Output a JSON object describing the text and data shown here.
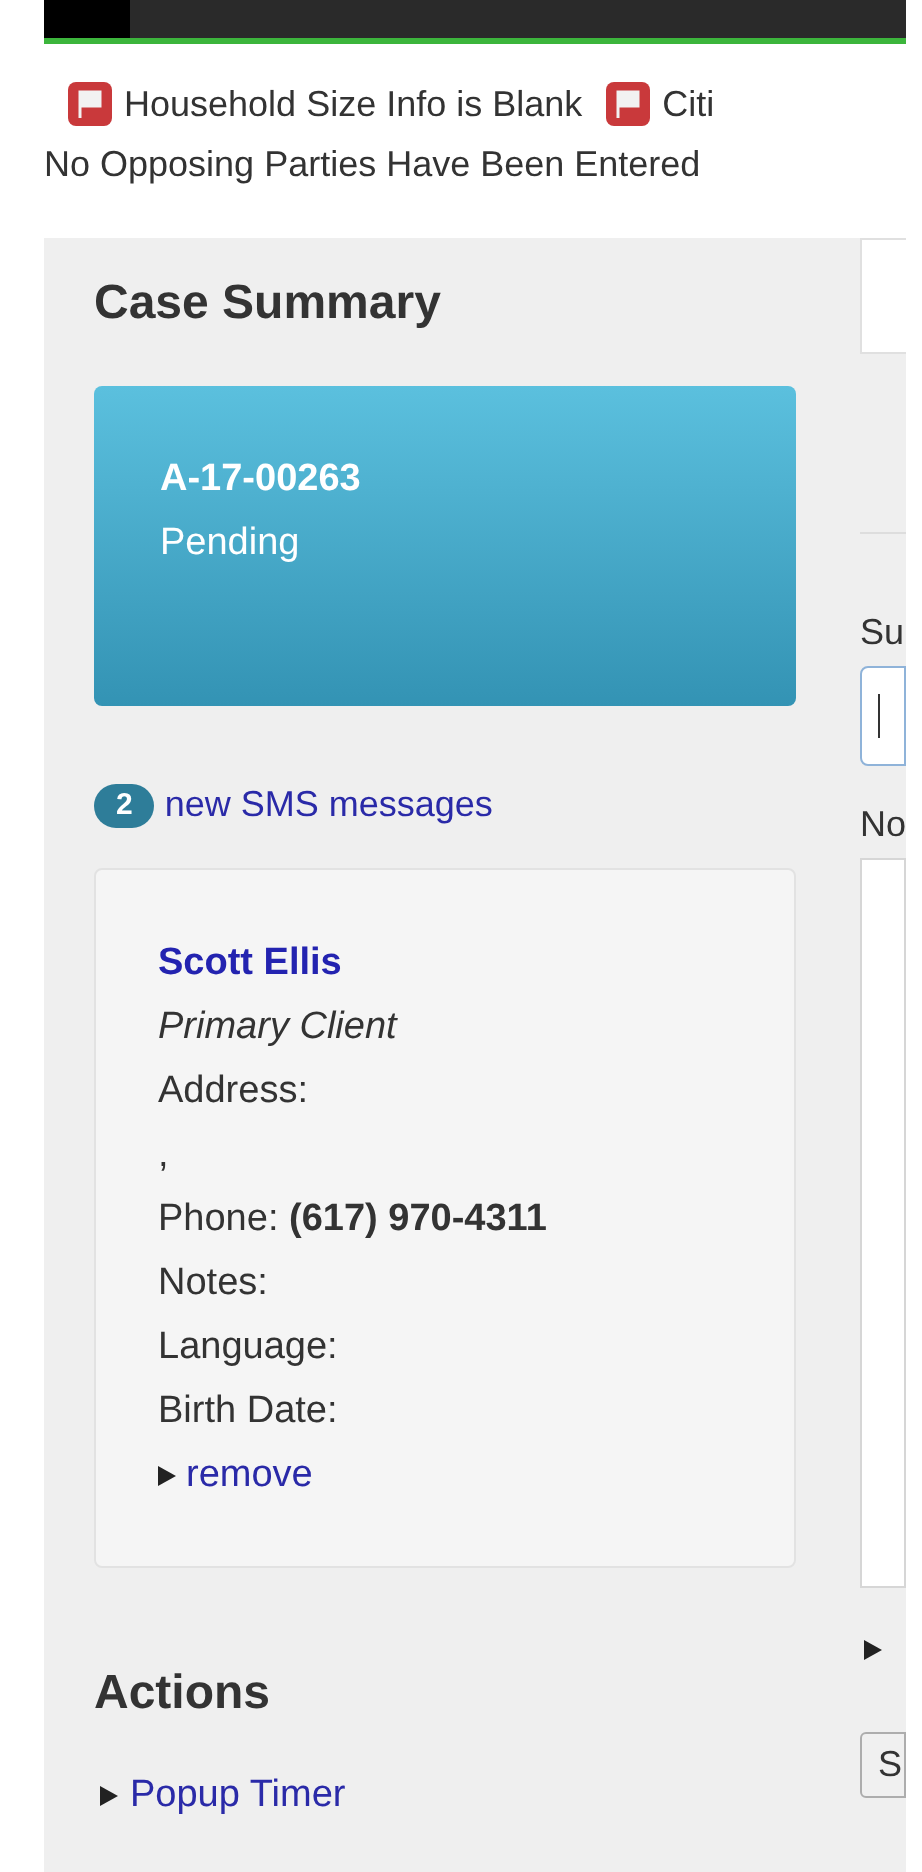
{
  "alerts": [
    {
      "kind": "flagged",
      "label": "Household Size Info is Blank"
    },
    {
      "kind": "flagged",
      "label": "Citi"
    },
    {
      "kind": "plain",
      "label": "No Opposing Parties Have Been Entered"
    }
  ],
  "case_summary": {
    "heading": "Case Summary",
    "case_number": "A-17-00263",
    "status": "Pending"
  },
  "sms": {
    "count": "2",
    "label": "new SMS messages"
  },
  "client": {
    "name": "Scott Ellis",
    "role": "Primary Client",
    "lines": [
      {
        "label": "Address:"
      },
      {
        "label": ","
      },
      {
        "label": "Phone:",
        "value": "(617) 970-4311"
      },
      {
        "label": "Notes:"
      },
      {
        "label": "Language:"
      },
      {
        "label": "Birth Date:"
      }
    ],
    "remove_link": "remove"
  },
  "actions": {
    "heading": "Actions",
    "links": [
      "Popup Timer"
    ]
  },
  "right_panel": {
    "subject_label": "Su",
    "notes_label": "No",
    "button": "S"
  }
}
